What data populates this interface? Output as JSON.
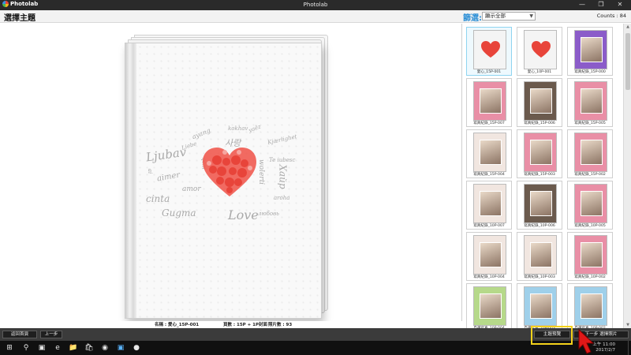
{
  "window": {
    "app_name": "Photolab",
    "title": "Photolab"
  },
  "header": {
    "page_title": "選擇主題",
    "filter_label": "篩選:",
    "filter_value": "顯示全部",
    "counts": "Counts : 84"
  },
  "preview": {
    "cloud_words": [
      "Ljubav",
      "ayang",
      "Liebe",
      "사랑",
      "aimer",
      "amor",
      "Gugma",
      "Love",
      "cinta",
      "Kjærlighet",
      "Te iubesc",
      "любовь",
      "Хайр",
      "wolerti",
      "aroha",
      "kokhav",
      "ai",
      "qèni",
      "yaêz"
    ],
    "heart_color": "#e8443a"
  },
  "info": {
    "name": "名稱 : 愛心_15P-001",
    "pages": "頁數 : 15P + 1P封面",
    "photos": "照片數 : 93"
  },
  "thumbnails": [
    {
      "label": "愛心_15P-001",
      "selected": true,
      "style": "heart"
    },
    {
      "label": "愛心_10P-001",
      "selected": false,
      "style": "heart"
    },
    {
      "label": "寫真紀錄_15P-000",
      "selected": false,
      "style": "purple"
    },
    {
      "label": "寫真紀錄_15P-007",
      "selected": false,
      "style": "pink"
    },
    {
      "label": "寫真紀錄_15P-006",
      "selected": false,
      "style": "dark"
    },
    {
      "label": "寫真紀錄_15P-005",
      "selected": false,
      "style": "pink"
    },
    {
      "label": "寫真紀錄_15P-004",
      "selected": false,
      "style": "light"
    },
    {
      "label": "寫真紀錄_15P-003",
      "selected": false,
      "style": "pink"
    },
    {
      "label": "寫真紀錄_15P-002",
      "selected": false,
      "style": "pink"
    },
    {
      "label": "寫真紀錄_10P-007",
      "selected": false,
      "style": "light"
    },
    {
      "label": "寫真紀錄_10P-006",
      "selected": false,
      "style": "dark"
    },
    {
      "label": "寫真紀錄_10P-005",
      "selected": false,
      "style": "pink"
    },
    {
      "label": "寫真紀錄_10P-004",
      "selected": false,
      "style": "light"
    },
    {
      "label": "寫真紀錄_10P-003",
      "selected": false,
      "style": "light"
    },
    {
      "label": "寫真紀錄_10P-002",
      "selected": false,
      "style": "pink"
    },
    {
      "label": "自選寫真_10P-004",
      "selected": false,
      "style": "green"
    },
    {
      "label": "自選寫真_10P-003",
      "selected": false,
      "style": "blue"
    },
    {
      "label": "自選寫真_10P-002",
      "selected": false,
      "style": "blue"
    }
  ],
  "thumb_styles": {
    "heart": "#f4f4f4",
    "purple": "#8b5cc9",
    "pink": "#e98fa6",
    "dark": "#6b5a4d",
    "light": "#f1e6e0",
    "green": "#b6d98a",
    "blue": "#9fd0ea"
  },
  "nav": {
    "back_home": "返回首頁",
    "prev_step": "上一步",
    "preview_button": "主題預覽",
    "next_step": "下一步 選擇照片"
  },
  "taskbar": {
    "time": "上午 11:00",
    "date": "2017/2/7"
  },
  "colors": {
    "accent": "#2c8fd6",
    "highlight": "#f5d21b",
    "cursor": "#e01818"
  }
}
